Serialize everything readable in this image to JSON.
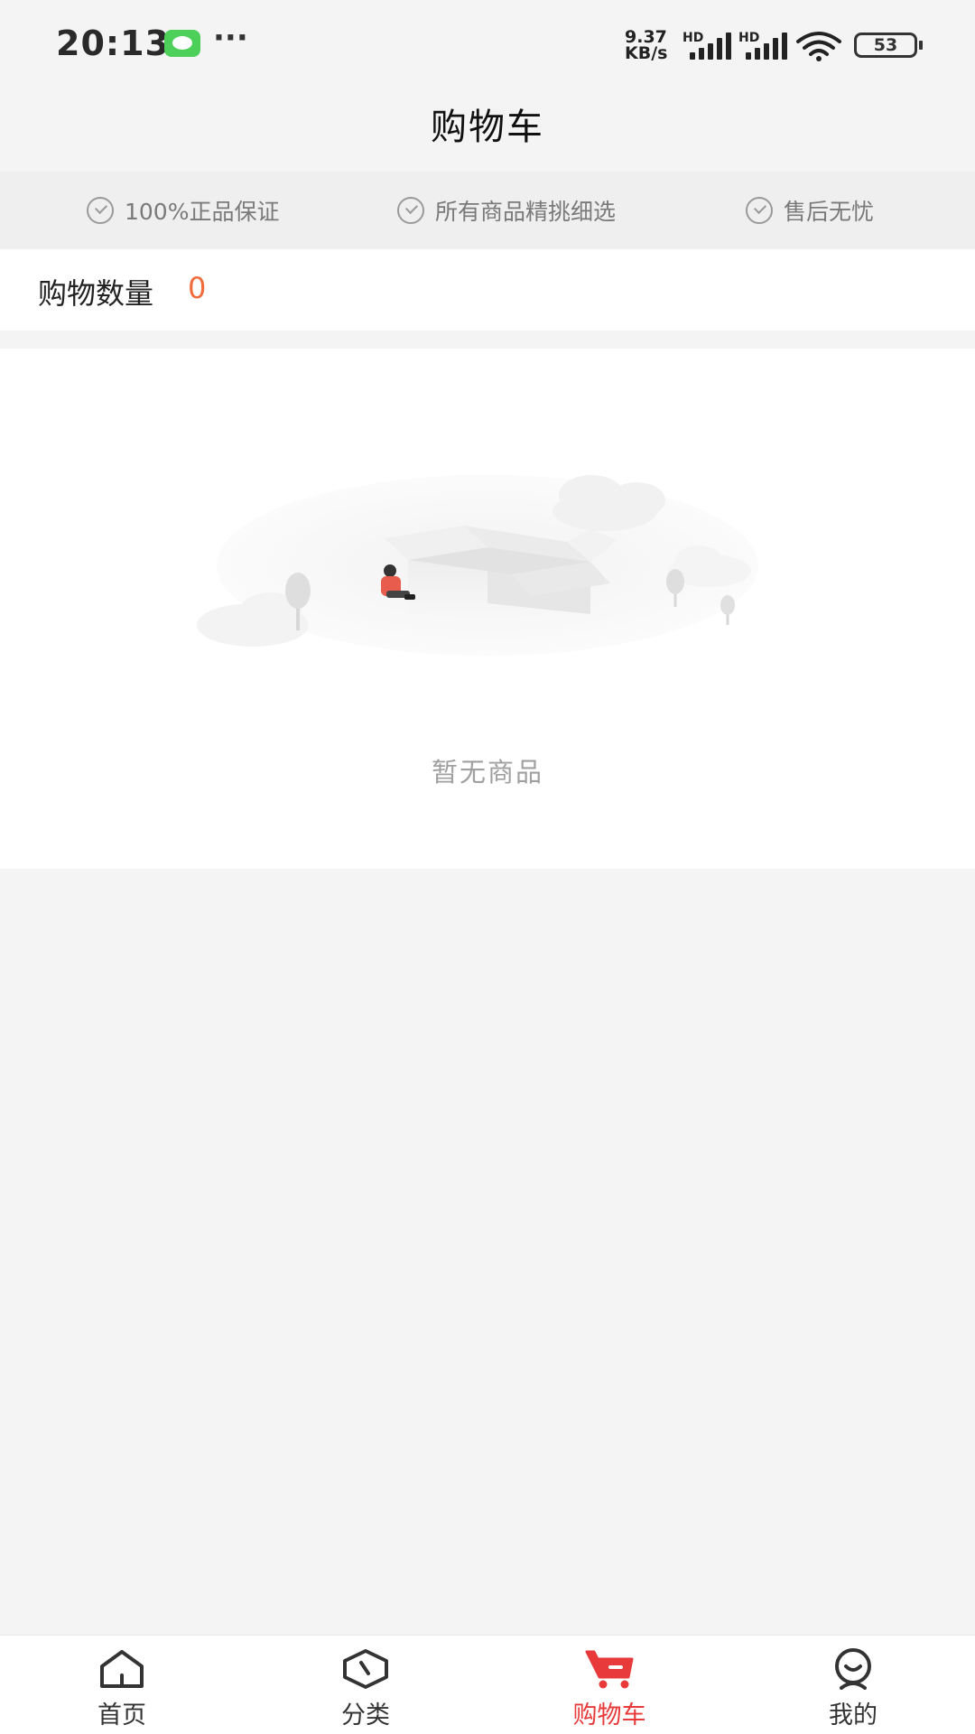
{
  "status_bar": {
    "time": "20:13",
    "more": "···",
    "net_speed_value": "9.37",
    "net_speed_unit": "KB/s",
    "signal_label_1": "HD",
    "signal_label_2": "HD",
    "battery": "53"
  },
  "header": {
    "title": "购物车"
  },
  "guarantees": [
    {
      "label": "100%正品保证",
      "icon": "check-circle-icon"
    },
    {
      "label": "所有商品精挑细选",
      "icon": "check-circle-icon"
    },
    {
      "label": "售后无忧",
      "icon": "check-circle-icon"
    }
  ],
  "cart": {
    "count_label": "购物数量",
    "count_value": "0"
  },
  "empty_state": {
    "message": "暂无商品",
    "illustration": "empty-box-illustration"
  },
  "tab_bar": {
    "tabs": [
      {
        "label": "首页",
        "icon": "home-icon"
      },
      {
        "label": "分类",
        "icon": "category-icon"
      },
      {
        "label": "购物车",
        "icon": "cart-icon",
        "active": true
      },
      {
        "label": "我的",
        "icon": "profile-icon"
      }
    ]
  },
  "colors": {
    "accent": "#e83a3a",
    "count": "#f26b3a",
    "background": "#f4f4f4"
  }
}
